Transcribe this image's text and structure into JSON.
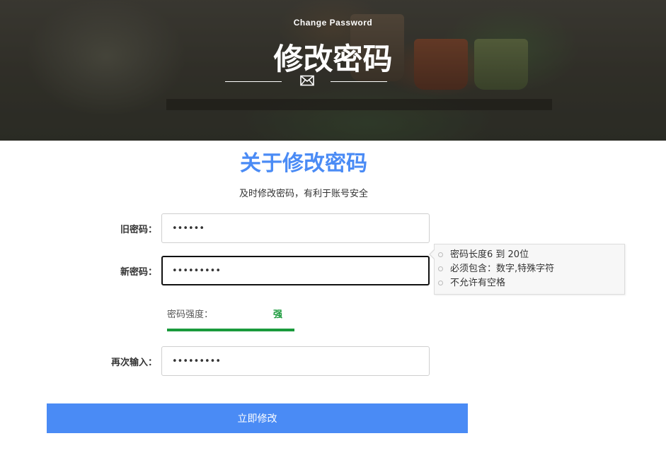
{
  "hero": {
    "subtitle": "Change Password",
    "title": "修改密码",
    "icon": "envelope-icon"
  },
  "section": {
    "title": "关于修改密码",
    "description": "及时修改密码，有利于账号安全"
  },
  "form": {
    "old_password": {
      "label": "旧密码：",
      "value": "••••••"
    },
    "new_password": {
      "label": "新密码：",
      "value": "•••••••••"
    },
    "confirm_password": {
      "label": "再次输入：",
      "value": "•••••••••"
    }
  },
  "strength": {
    "label": "密码强度：",
    "value": "强",
    "level_percent": 100,
    "color": "#1a9a3c"
  },
  "tooltip": {
    "rules": [
      "密码长度6 到 20位",
      "必须包含：数字,特殊字符",
      "不允许有空格"
    ]
  },
  "submit": {
    "label": "立即修改"
  },
  "colors": {
    "accent": "#4a8bf5",
    "strength_strong": "#1a9a3c"
  }
}
